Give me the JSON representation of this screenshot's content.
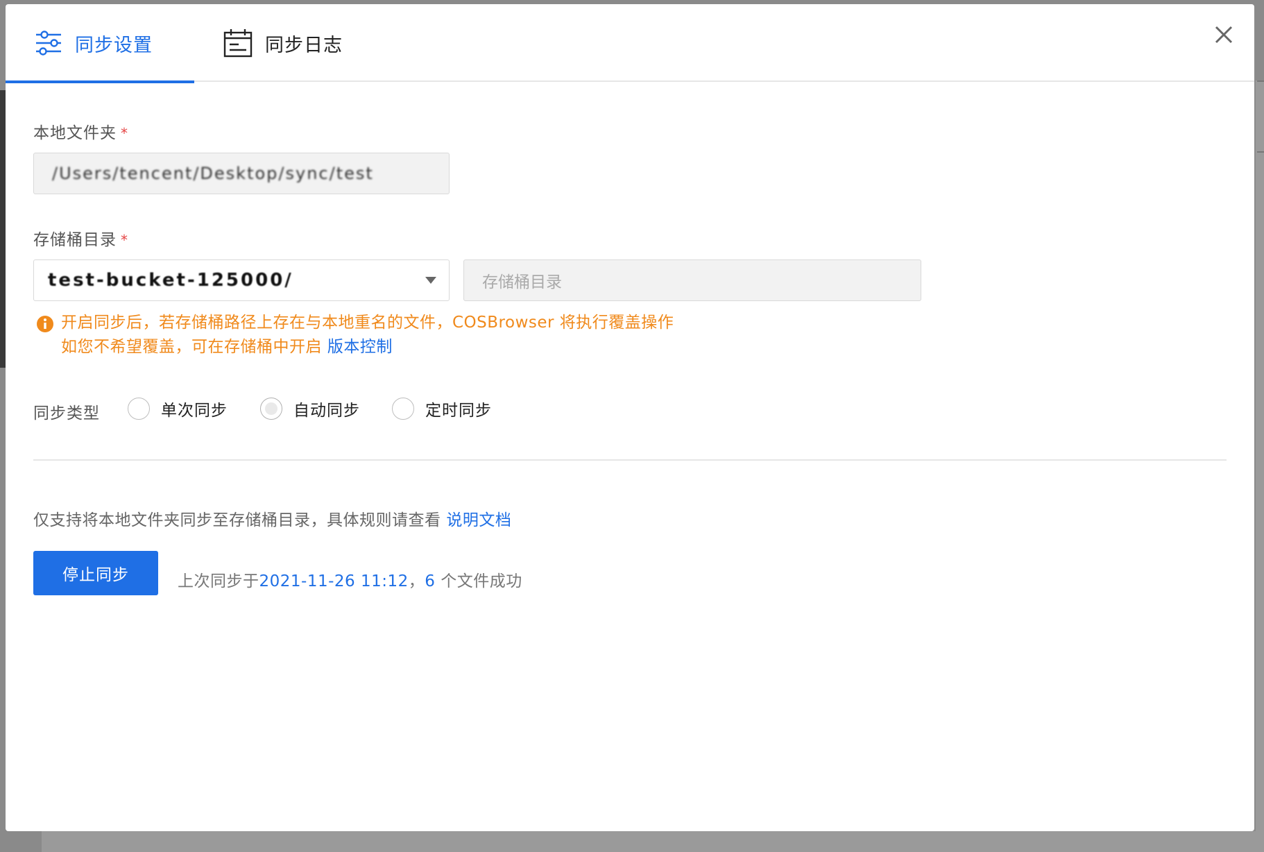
{
  "tabs": [
    {
      "label": "同步设置",
      "icon": "sliders-icon",
      "active": true
    },
    {
      "label": "同步日志",
      "icon": "calendar-icon",
      "active": false
    }
  ],
  "form": {
    "local_folder": {
      "label": "本地文件夹",
      "required_mark": "*",
      "value": "/Users/tencent/Desktop/sync/test"
    },
    "bucket_dir": {
      "label": "存储桶目录",
      "required_mark": "*",
      "selected_value": "test-bucket-125000/",
      "placeholder": "存储桶目录"
    },
    "warning": {
      "line1": "开启同步后，若存储桶路径上存在与本地重名的文件，COSBrowser 将执行覆盖操作",
      "line2_prefix": "如您不希望覆盖，可在存储桶中开启 ",
      "line2_link": "版本控制"
    },
    "sync_type": {
      "label": "同步类型",
      "options": [
        "单次同步",
        "自动同步",
        "定时同步"
      ],
      "selected": "自动同步"
    }
  },
  "footer": {
    "help_prefix": "仅支持将本地文件夹同步至存储桶目录，具体规则请查看 ",
    "help_link": "说明文档",
    "stop_button": "停止同步",
    "last_sync_prefix": "上次同步于",
    "last_sync_time": "2021-11-26 11:12",
    "sep": "，",
    "file_count": "6",
    "last_sync_suffix": " 个文件成功"
  },
  "colors": {
    "primary": "#1f6fe5",
    "warning": "#f08a1c",
    "required": "#e54545"
  }
}
